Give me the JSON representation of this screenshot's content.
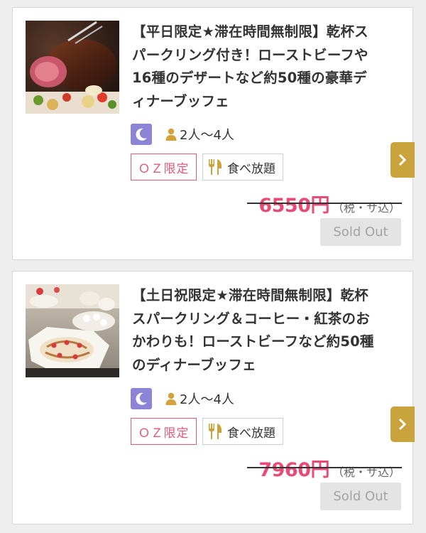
{
  "plans": [
    {
      "title": "【平日限定★滞在時間無制限】乾杯スパークリング付き！ローストビーフや16種のデザートなど約50種の豪華ディナーブッフェ",
      "time_icon": "moon-icon",
      "people": "2人〜4人",
      "tags": {
        "oz": "ＯＺ限定",
        "buffet": "食べ放題"
      },
      "price": "6550円",
      "tax": "（税・サ込）",
      "status": "Sold Out",
      "image": "roast-beef-photo"
    },
    {
      "title": "【土日祝限定★滞在時間無制限】乾杯スパークリング＆コーヒー・紅茶のおかわりも！ローストビーフなど約50種のディナーブッフェ",
      "time_icon": "moon-icon",
      "people": "2人〜4人",
      "tags": {
        "oz": "ＯＺ限定",
        "buffet": "食べ放題"
      },
      "price": "7960円",
      "tax": "（税・サ込）",
      "status": "Sold Out",
      "image": "dessert-buffet-photo"
    }
  ],
  "colors": {
    "accent_pink": "#e84b75",
    "oz_border": "#e05a7a",
    "arrow_gold": "#c9a43d",
    "moon_purple": "#8c84d4",
    "person_gold": "#d4a23a"
  }
}
